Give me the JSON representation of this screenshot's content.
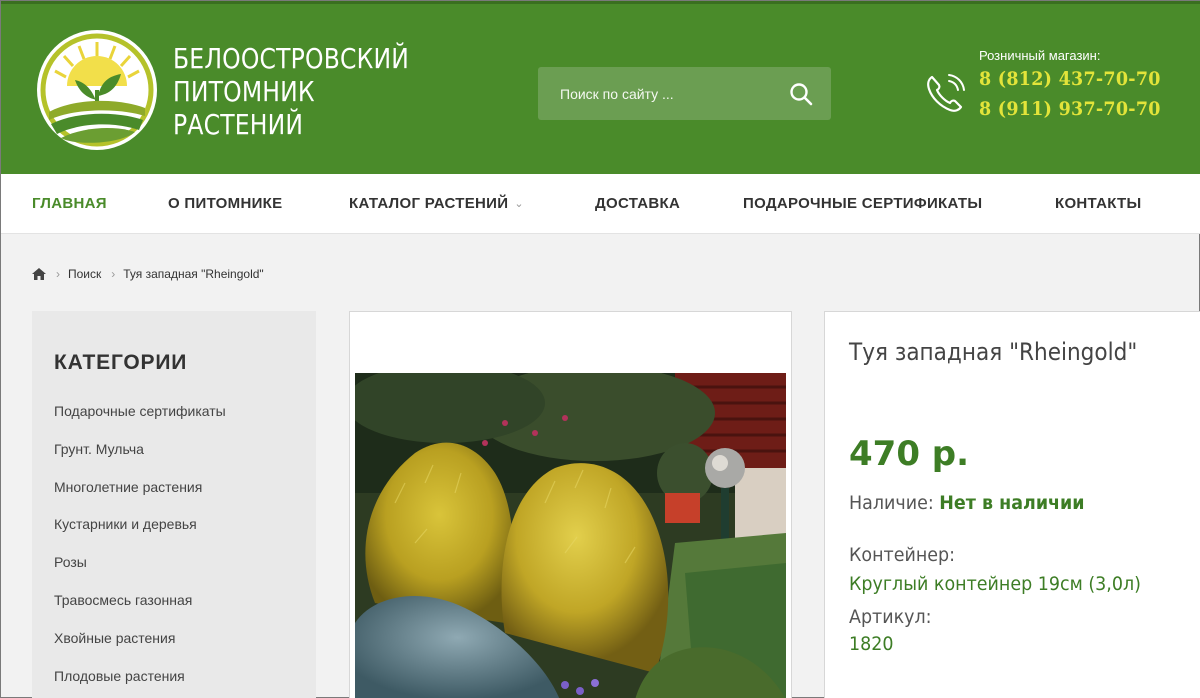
{
  "header": {
    "brand_lines": [
      "БЕЛООСТРОВСКИЙ",
      "ПИТОМНИК",
      "РАСТЕНИЙ"
    ],
    "search_placeholder": "Поиск по сайту ...",
    "retail_label": "Розничный магазин:",
    "phones": [
      "8 (812) 437-70-70",
      "8 (911) 937-70-70"
    ]
  },
  "nav": {
    "items": [
      {
        "label": "ГЛАВНАЯ",
        "active": true
      },
      {
        "label": "О ПИТОМНИКЕ"
      },
      {
        "label": "КАТАЛОГ РАСТЕНИЙ",
        "has_dropdown": true
      },
      {
        "label": "ДОСТАВКА"
      },
      {
        "label": "ПОДАРОЧНЫЕ СЕРТИФИКАТЫ"
      },
      {
        "label": "КОНТАКТЫ"
      }
    ]
  },
  "breadcrumb": {
    "items": [
      "Поиск",
      "Туя западная \"Rheingold\""
    ]
  },
  "sidebar": {
    "title": "КАТЕГОРИИ",
    "items": [
      "Подарочные сертификаты",
      "Грунт. Мульча",
      "Многолетние растения",
      "Кустарники и деревья",
      "Розы",
      "Травосмесь газонная",
      "Хвойные растения",
      "Плодовые растения"
    ]
  },
  "product": {
    "title": "Туя западная \"Rheingold\"",
    "price": "470 р.",
    "availability_label": "Наличие:",
    "availability_value": "Нет в наличии",
    "container_label": "Контейнер:",
    "container_value": "Круглый контейнер 19см (3,0л)",
    "sku_label": "Артикул:",
    "sku_value": "1820"
  },
  "colors": {
    "header_green": "#4a8b2a",
    "accent_green": "#3d7d25",
    "phone_yellow": "#e3e43a"
  }
}
